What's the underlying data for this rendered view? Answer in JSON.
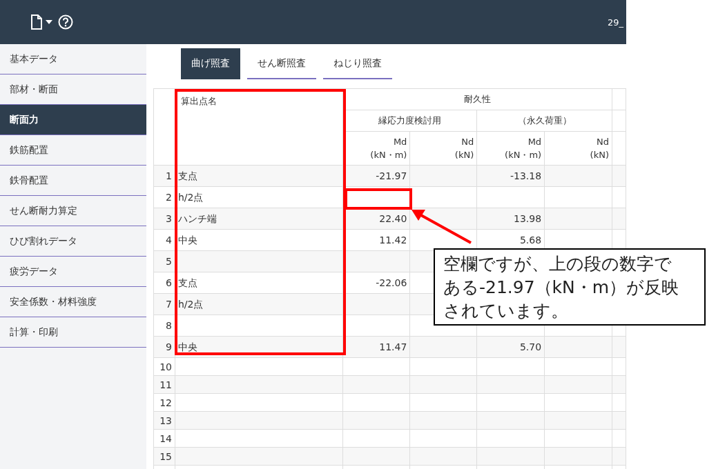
{
  "header": {
    "title": "29_"
  },
  "sidebar": {
    "items": [
      {
        "label": "基本データ",
        "selected": false
      },
      {
        "label": "部材・断面",
        "selected": false
      },
      {
        "label": "断面力",
        "selected": true
      },
      {
        "label": "鉄筋配置",
        "selected": false
      },
      {
        "label": "鉄骨配置",
        "selected": false
      },
      {
        "label": "せん断耐力算定",
        "selected": false
      },
      {
        "label": "ひび割れデータ",
        "selected": false
      },
      {
        "label": "疲労データ",
        "selected": false
      },
      {
        "label": "安全係数・材料強度",
        "selected": false
      },
      {
        "label": "計算・印刷",
        "selected": false
      }
    ]
  },
  "tabs": [
    {
      "label": "曲げ照査",
      "selected": true
    },
    {
      "label": "せん断照査",
      "selected": false
    },
    {
      "label": "ねじり照査",
      "selected": false
    }
  ],
  "table": {
    "name_header": "算出点名",
    "group_header": "耐久性",
    "subgroups": [
      "縁応力度検討用",
      "（永久荷重）"
    ],
    "columns": [
      {
        "label": "Md",
        "unit": "(kN・m)"
      },
      {
        "label": "Nd",
        "unit": "(kN)"
      },
      {
        "label": "Md",
        "unit": "(kN・m)"
      },
      {
        "label": "Nd",
        "unit": "(kN)"
      }
    ],
    "rows": [
      {
        "number": "1",
        "name": "支点",
        "cells": [
          "-21.97",
          "",
          "-13.18",
          ""
        ]
      },
      {
        "number": "2",
        "name": "h/2点",
        "cells": [
          "",
          "",
          "",
          ""
        ]
      },
      {
        "number": "3",
        "name": "ハンチ端",
        "cells": [
          "22.40",
          "",
          "13.98",
          ""
        ]
      },
      {
        "number": "4",
        "name": "中央",
        "cells": [
          "11.42",
          "",
          "5.68",
          ""
        ]
      },
      {
        "number": "5",
        "name": "",
        "cells": [
          "",
          "",
          "",
          ""
        ]
      },
      {
        "number": "6",
        "name": "支点",
        "cells": [
          "-22.06",
          "",
          "",
          ""
        ]
      },
      {
        "number": "7",
        "name": "h/2点",
        "cells": [
          "",
          "",
          "",
          ""
        ]
      },
      {
        "number": "8",
        "name": "",
        "cells": [
          "",
          "",
          "",
          ""
        ]
      },
      {
        "number": "9",
        "name": "中央",
        "cells": [
          "11.47",
          "",
          "5.70",
          ""
        ]
      },
      {
        "number": "10",
        "name": "",
        "cells": [
          "",
          "",
          "",
          ""
        ]
      },
      {
        "number": "11",
        "name": "",
        "cells": [
          "",
          "",
          "",
          ""
        ]
      },
      {
        "number": "12",
        "name": "",
        "cells": [
          "",
          "",
          "",
          ""
        ]
      },
      {
        "number": "13",
        "name": "",
        "cells": [
          "",
          "",
          "",
          ""
        ]
      },
      {
        "number": "14",
        "name": "",
        "cells": [
          "",
          "",
          "",
          ""
        ]
      },
      {
        "number": "15",
        "name": "",
        "cells": [
          "",
          "",
          "",
          ""
        ]
      }
    ]
  },
  "annotation": {
    "callout": "空欄ですが、上の段の数字である-21.97（kN・m）が反映されています。"
  }
}
